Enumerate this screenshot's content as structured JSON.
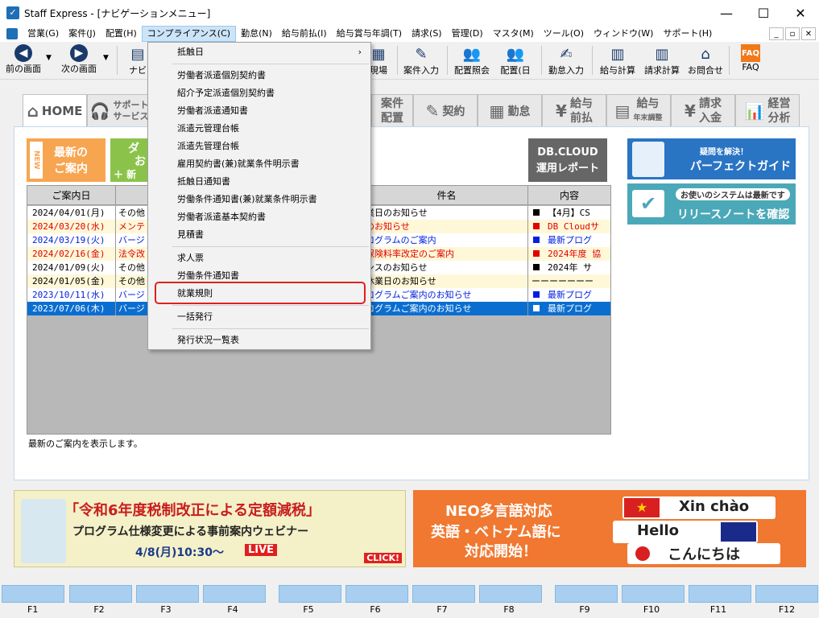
{
  "window": {
    "title": "Staff Express - [ナビゲーションメニュー]",
    "minimize": "—",
    "maximize": "☐",
    "close": "✕"
  },
  "menubar": [
    "営業(G)",
    "案件(J)",
    "配置(H)",
    "コンプライアンス(C)",
    "勤怠(N)",
    "給与前払(I)",
    "給与賞与年調(T)",
    "請求(S)",
    "管理(D)",
    "マスタ(M)",
    "ツール(O)",
    "ウィンドウ(W)",
    "サポート(H)"
  ],
  "toolbar": {
    "back": "前の画面",
    "forward": "次の画面",
    "navi": "ナビ",
    "site": "現場",
    "case_input": "案件入力",
    "placement_inquiry": "配置照会",
    "placement_day": "配置(日",
    "attendance_input": "勤怠入力",
    "salary_calc": "給与計算",
    "billing_calc": "請求計算",
    "inquiry": "お問合せ",
    "faq": "FAQ",
    "faq_icon": "FAQ"
  },
  "nav_tabs": {
    "home": "HOME",
    "support1": "サポート",
    "support2": "サービス",
    "case1": "案件",
    "case2": "配置",
    "contract": "契約",
    "attendance": "勤怠",
    "salary1": "給与",
    "salary2": "前払",
    "year1": "給与",
    "year2": "年末調整",
    "billing1": "請求",
    "billing2": "入金",
    "mgmt1": "経営",
    "mgmt2": "分析"
  },
  "new_box": {
    "tag": "NEW",
    "line1": "最新の",
    "line2": "ご案内"
  },
  "green_box": {
    "line1": "ダ",
    "line2": "お",
    "plus": "＋ 新"
  },
  "dbcloud": {
    "line1": "DB.CLOUD",
    "line2": "運用レポート"
  },
  "table": {
    "headers": [
      "ご案内日",
      "",
      "件名",
      "内容"
    ],
    "rows": [
      {
        "date": "2024/04/01(月)",
        "cat": "その他",
        "subject": "業日のお知らせ",
        "sq": "#000000",
        "content": "【4月】CS",
        "fg": "#000000",
        "bg": "#ffffff"
      },
      {
        "date": "2024/03/20(水)",
        "cat": "メンテ",
        "subject": "のお知らせ",
        "sq": "#e00000",
        "content": "DB Cloudサ",
        "fg": "#e00000",
        "bg": "#fff8d8"
      },
      {
        "date": "2024/03/19(火)",
        "cat": "バージ",
        "subject": "ログラムのご案内",
        "sq": "#0020e0",
        "content": "最新プログ",
        "fg": "#0020e0",
        "bg": "#ffffff"
      },
      {
        "date": "2024/02/16(金)",
        "cat": "法令改",
        "subject": "保険料率改定のご案内",
        "sq": "#e00000",
        "content": "2024年度 協",
        "fg": "#e00000",
        "bg": "#fff8d8"
      },
      {
        "date": "2024/01/09(火)",
        "cat": "その他",
        "subject": "ンスのお知らせ",
        "sq": "#000000",
        "content": "2024年 サ",
        "fg": "#000000",
        "bg": "#ffffff"
      },
      {
        "date": "2024/01/05(金)",
        "cat": "その他",
        "subject": "休業日のお知らせ",
        "sq": "",
        "content": "ーーーーーーー",
        "fg": "#000000",
        "bg": "#fff8d8"
      },
      {
        "date": "2023/10/11(水)",
        "cat": "バージ",
        "subject": "ログラムご案内のお知らせ",
        "sq": "#0020e0",
        "content": "最新プログ",
        "fg": "#0020e0",
        "bg": "#ffffff"
      },
      {
        "date": "2023/07/06(木)",
        "cat": "バージ",
        "subject": "ログラムご案内のお知らせ",
        "sq": "#ffffff",
        "content": "最新プログ",
        "fg": "#ffffff",
        "bg": "#0a6ed1"
      }
    ]
  },
  "status_text": "最新のご案内を表示します。",
  "guide": {
    "g1_small": "疑問を解決！",
    "g1_big": "パーフェクトガイド",
    "g2_small": "お使いのシステムは最新です",
    "g2_big": "リリースノートを確認"
  },
  "banner1": {
    "line1": "「令和6年度税制改正による定額減税」",
    "line2": "プログラム仕様変更による事前案内ウェビナー",
    "line3": "4/8(月)10:30～",
    "live": "LIVE",
    "click": "CLICK!"
  },
  "banner2": {
    "line1": "NEO多言語対応",
    "line2": "英語・ベトナム語に",
    "line3": "対応開始！",
    "vn": "Xin chào",
    "en": "Hello",
    "jp": "こんにちは"
  },
  "fkeys": [
    "F1",
    "F2",
    "F3",
    "F4",
    "F5",
    "F6",
    "F7",
    "F8",
    "F9",
    "F10",
    "F11",
    "F12"
  ],
  "dropdown": {
    "items": [
      {
        "label": "抵触日",
        "submenu": true
      },
      {
        "label": "労働者派遣個別契約書"
      },
      {
        "label": "紹介予定派遣個別契約書"
      },
      {
        "label": "労働者派遣通知書"
      },
      {
        "label": "派遣元管理台帳"
      },
      {
        "label": "派遣先管理台帳"
      },
      {
        "label": "雇用契約書(兼)就業条件明示書"
      },
      {
        "label": "抵触日通知書"
      },
      {
        "label": "労働条件通知書(兼)就業条件明示書"
      },
      {
        "label": "労働者派遣基本契約書"
      },
      {
        "label": "見積書"
      },
      {
        "label": "求人票"
      },
      {
        "label": "労働条件通知書"
      },
      {
        "label": "就業規則"
      },
      {
        "label": "一括発行"
      },
      {
        "label": "発行状況一覧表"
      }
    ],
    "submenu_arrow": "›"
  }
}
